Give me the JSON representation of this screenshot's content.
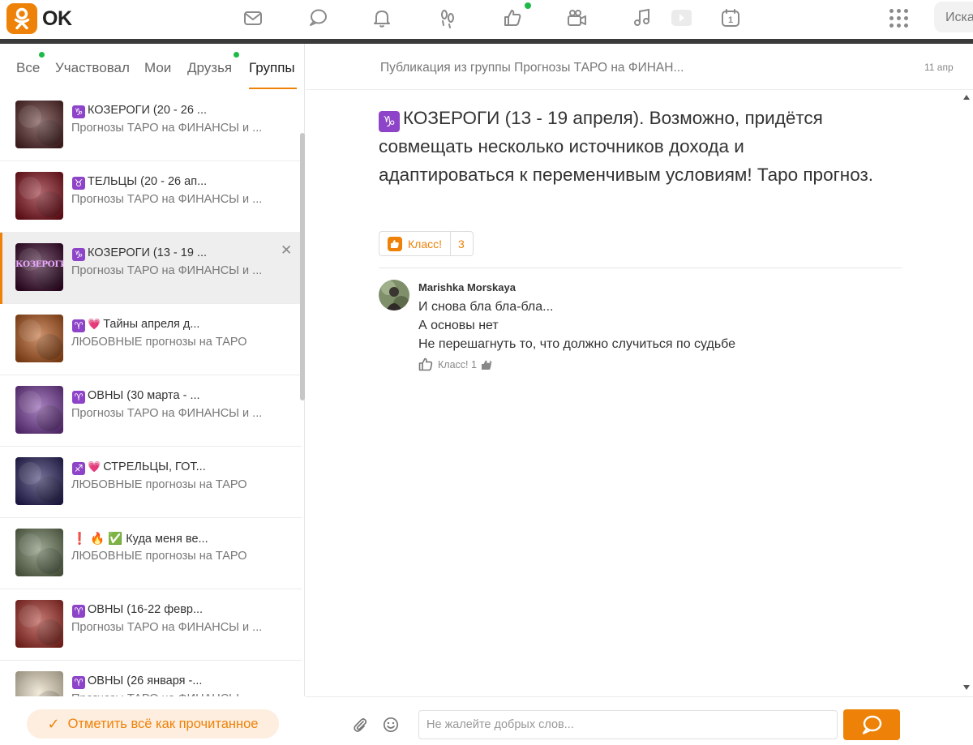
{
  "brand": {
    "name": "OK",
    "accent": "#ee8208",
    "online": "#1fb949"
  },
  "topbar": {
    "icons": [
      "mail-icon",
      "chat-icon",
      "bell-icon",
      "footprints-icon",
      "like-icon",
      "video-icon",
      "music-icon",
      "play-icon",
      "calendar-icon"
    ],
    "calendar_day": "1",
    "search_text": "Иска"
  },
  "tabs": [
    {
      "label": "Все"
    },
    {
      "label": "Участвовал"
    },
    {
      "label": "Мои"
    },
    {
      "label": "Друзья"
    },
    {
      "label": "Группы"
    }
  ],
  "active_tab": "Группы",
  "discussions": [
    {
      "sign": "♑",
      "title": "КОЗЕРОГИ (20 - 26 ...",
      "sub": "Прогнозы ТАРО на ФИНАНСЫ и ...",
      "palette": "#5a2b2b"
    },
    {
      "sign": "♉",
      "title": "ТЕЛЬЦЫ (20 - 26 ап...",
      "sub": "Прогнозы ТАРО на ФИНАНСЫ и ...",
      "palette": "#8a1520"
    },
    {
      "sign": "♑",
      "title": "КОЗЕРОГИ (13 - 19 ...",
      "sub": "Прогнозы ТАРО на ФИНАНСЫ и ...",
      "palette": "#3a0a2c",
      "thumb_text": "КОЗЕРОГИ"
    },
    {
      "sign": "♈",
      "heart": "💗",
      "title": "Тайны апреля д...",
      "sub": "ЛЮБОВНЫЕ прогнозы на ТАРО",
      "palette": "#b55a1f"
    },
    {
      "sign": "♈",
      "title": "ОВНЫ (30 марта - ...",
      "sub": "Прогнозы ТАРО на ФИНАНСЫ и ...",
      "palette": "#7a3f9e"
    },
    {
      "sign": "♐",
      "heart": "💗",
      "title": "СТРЕЛЬЦЫ, ГОТ...",
      "sub": "ЛЮБОВНЫЕ прогнозы на ТАРО",
      "palette": "#2b2560"
    },
    {
      "prefix": "❗ 🔥 ✅",
      "title": "Куда меня ве...",
      "sub": "ЛЮБОВНЫЕ прогнозы на ТАРО",
      "palette": "#6b7a5a"
    },
    {
      "sign": "♈",
      "title": "ОВНЫ (16-22 февр...",
      "sub": "Прогнозы ТАРО на ФИНАНСЫ и ...",
      "palette": "#a8322a"
    },
    {
      "sign": "♈",
      "title": "ОВНЫ (26 января -...",
      "sub": "Прогнозы ТАРО на ФИНАНСЫ",
      "palette": "#e9dcc2"
    }
  ],
  "selected_index": 2,
  "left_footer": {
    "mark_read_label": "Отметить всё как прочитанное"
  },
  "post": {
    "from": "Публикация из группы Прогнозы ТАРО на ФИНАН...",
    "date": "11 апр",
    "sign": "♑",
    "title": "КОЗЕРОГИ (13 - 19 апреля). Возможно, придётся совмещать несколько источников дохода и адаптироваться к переменчивым условиям! Таро прогноз.",
    "like_label": "Класс!",
    "like_count": "3"
  },
  "comment": {
    "author": "Marishka Morskaya",
    "lines": [
      "И снова бла бла-бла...",
      "А основы нет",
      "Не перешагнуть то, что должно случиться по судьбе"
    ],
    "like_label": "Класс! 1"
  },
  "composer": {
    "placeholder": "Не жалейте добрых слов..."
  }
}
